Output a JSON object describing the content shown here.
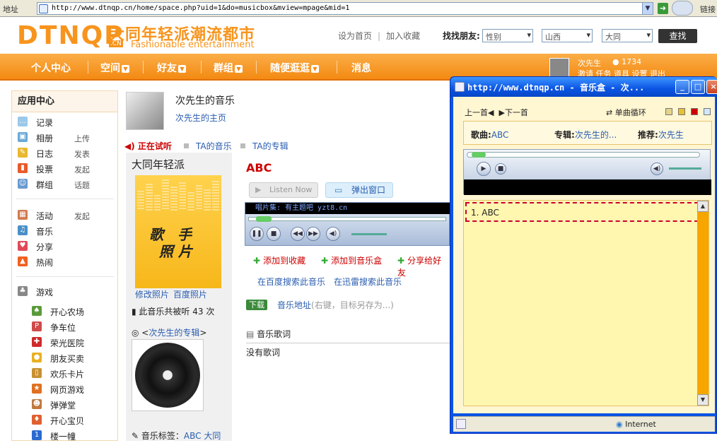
{
  "browser": {
    "address_label": "地址",
    "url": "http://www.dtnqp.cn/home/space.php?uid=1&do=musicbox&mview=mpage&mid=1",
    "links_label": "链接"
  },
  "header": {
    "logo_main": "DTNQP",
    "logo_cn": "大同年轻派潮流都市",
    "logo_en": "Fashionable entertainment",
    "logo_tag": ".CN",
    "set_home": "设为首页",
    "bookmark": "加入收藏",
    "find_label": "找找朋友:",
    "gender_select": "性别",
    "province_select": "山西",
    "city_select": "大同",
    "search_button": "查找"
  },
  "nav": {
    "items": [
      "个人中心",
      "空间",
      "好友",
      "群组",
      "随便逛逛",
      "消息"
    ],
    "username": "次先生",
    "coins": "1734",
    "user_links": "激请 任务 道具 设置 退出"
  },
  "sidebar": {
    "title": "应用中心",
    "apps": [
      {
        "label": "记录",
        "action": ""
      },
      {
        "label": "相册",
        "action": "上传"
      },
      {
        "label": "日志",
        "action": "发表"
      },
      {
        "label": "投票",
        "action": "发起"
      },
      {
        "label": "群组",
        "action": "话题"
      }
    ],
    "apps2": [
      {
        "label": "活动",
        "action": "发起"
      },
      {
        "label": "音乐",
        "action": ""
      },
      {
        "label": "分享",
        "action": ""
      },
      {
        "label": "热闹",
        "action": ""
      }
    ],
    "games_title": "游戏",
    "games": [
      "开心农场",
      "争车位",
      "荣光医院",
      "朋友买卖",
      "欢乐卡片",
      "网页游戏",
      "弹弹堂",
      "开心宝贝",
      "楼一幢"
    ]
  },
  "profile": {
    "title": "次先生的音乐",
    "home_link": "次先生的主页"
  },
  "tabs": {
    "now_playing": "正在试听",
    "ta_music": "TA的音乐",
    "ta_albums": "TA的专辑"
  },
  "left_col": {
    "title": "大同年轻派",
    "album_text": "歌 手\n照 片",
    "edit_photo": "修改照片",
    "baidu_photo": "百度照片",
    "plays": "此音乐共被听 43 次",
    "album_prefix": "<",
    "album_link": "次先生的专辑",
    "album_suffix": ">",
    "tag_label": "音乐标签：",
    "tag_value": "ABC 大同"
  },
  "main": {
    "song_title": "ABC",
    "listen_now": "Listen Now",
    "popup": "弹出窗口",
    "player_strip": "唱片集: 有主题吧 yzt8.cn",
    "add_fav": "添加到收藏",
    "add_box": "添加到音乐盒",
    "share": "分享给好友",
    "search_baidu": "在百度搜索此音乐",
    "search_xunlei": "在迅雷搜索此音乐",
    "download": "下载",
    "music_addr": "音乐地址",
    "music_hint": "(右键，目标另存为...)",
    "lyrics_title": "音乐歌词",
    "lyrics_text": "没有歌词"
  },
  "popup_window": {
    "title": "http://www.dtnqp.cn - 音乐盒 - 次...",
    "prev": "上一首◀",
    "next": "▶下一首",
    "loop": "单曲循环",
    "song_label": "歌曲:",
    "song_value": "ABC",
    "album_label": "专辑:",
    "album_value": "次先生的...",
    "recommend_label": "推荐:",
    "recommend_value": "次先生",
    "playlist": [
      "1. ABC"
    ],
    "status": "Internet",
    "swatch_colors": [
      "#e2d48a",
      "#e8c030",
      "#cc0000",
      "#d0e8f8"
    ]
  }
}
